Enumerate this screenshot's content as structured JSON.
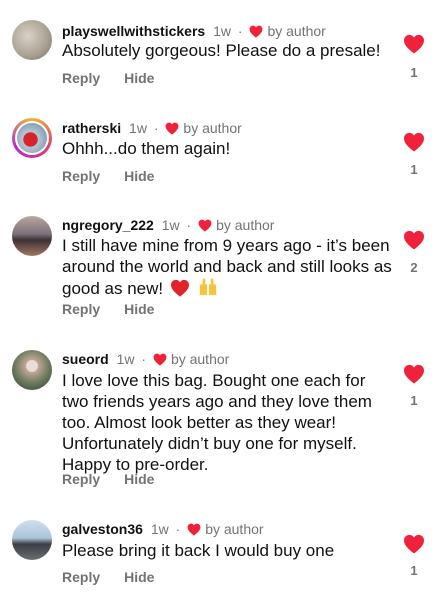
{
  "ui": {
    "by_author": "by author",
    "reply": "Reply",
    "hide": "Hide",
    "heart_color": "#f0213b"
  },
  "comments": [
    {
      "username": "playswellwithstickers",
      "time": "1w",
      "text": "Absolutely gorgeous! Please do a presale!",
      "likes": "1"
    },
    {
      "username": "ratherski",
      "time": "1w",
      "text": "Ohhh...do them again!",
      "likes": "1"
    },
    {
      "username": "ngregory_222",
      "time": "1w",
      "text": "I still have mine from 9 years ago - it’s been around the world and back and still looks as good as new!",
      "likes": "2",
      "emojis": [
        "red-heart-emoji",
        "raised-hands-emoji"
      ]
    },
    {
      "username": "sueord",
      "time": "1w",
      "text": "I love love this bag. Bought one each for two friends years ago and they love them too. Almost look better as they wear! Unfortunately didn’t buy one for myself. Happy to pre-order.",
      "likes": "1"
    },
    {
      "username": "galveston36",
      "time": "1w",
      "text": "Please bring it back I would buy one",
      "likes": "1"
    }
  ]
}
